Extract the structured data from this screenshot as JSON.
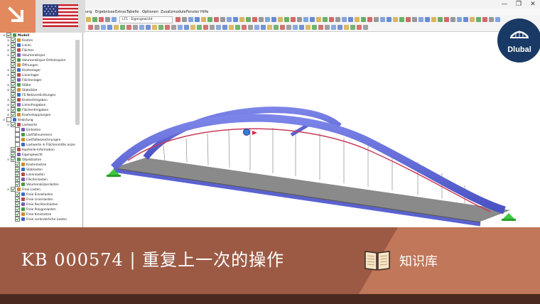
{
  "window": {
    "minimize": "—",
    "maximize": "❐",
    "close": "✕"
  },
  "menu": {
    "items": [
      "ung",
      "Ergebnisse",
      "Extras",
      "Tabelle",
      "Optionen",
      "Zusatzmodule",
      "Fenster",
      "Hilfe"
    ]
  },
  "toolbar": {
    "loadcase": "LF1 - Eigengewicht"
  },
  "navigator": {
    "rows": [
      {
        "label": "Modell",
        "level": 0,
        "checked": true,
        "expand": "⊟",
        "bold": true
      },
      {
        "label": "Knoten",
        "level": 1,
        "checked": true,
        "expand": "⊞"
      },
      {
        "label": "Linien",
        "level": 1,
        "checked": true,
        "expand": "⊞"
      },
      {
        "label": "Flächen",
        "level": 1,
        "checked": true,
        "expand": "⊞"
      },
      {
        "label": "Volumenkörper",
        "level": 1,
        "checked": true,
        "expand": "⊞"
      },
      {
        "label": "Volumenkörper-Orthotropien",
        "level": 1,
        "checked": true,
        "expand": ""
      },
      {
        "label": "Öffnungen",
        "level": 1,
        "checked": true,
        "expand": ""
      },
      {
        "label": "Knotenlager",
        "level": 1,
        "checked": true,
        "expand": "⊞"
      },
      {
        "label": "Linienlager",
        "level": 1,
        "checked": true,
        "expand": "⊞"
      },
      {
        "label": "Flächenlager",
        "level": 1,
        "checked": true,
        "expand": ""
      },
      {
        "label": "Stäbe",
        "level": 1,
        "checked": true,
        "expand": "⊞"
      },
      {
        "label": "Stabsätze",
        "level": 1,
        "checked": true,
        "expand": "⊞"
      },
      {
        "label": "FE-Netzverdichtungen",
        "level": 1,
        "checked": true,
        "expand": ""
      },
      {
        "label": "Knotenfreigaben",
        "level": 1,
        "checked": true,
        "expand": "⊞"
      },
      {
        "label": "Linienfreigaben",
        "level": 1,
        "checked": true,
        "expand": "⊞"
      },
      {
        "label": "Flächenfreigaben",
        "level": 1,
        "checked": true,
        "expand": "⊞"
      },
      {
        "label": "Knotenkopplungen",
        "level": 1,
        "checked": true,
        "expand": "⊞"
      },
      {
        "label": "Belastung",
        "level": 0,
        "checked": false,
        "expand": "⊟"
      },
      {
        "label": "Lastwerte",
        "level": 1,
        "checked": true,
        "expand": "⊟"
      },
      {
        "label": "Einheiten",
        "level": 2,
        "checked": false,
        "expand": ""
      },
      {
        "label": "Lastfallnummern",
        "level": 2,
        "checked": false,
        "expand": ""
      },
      {
        "label": "Lastfallbezeichnungen",
        "level": 2,
        "checked": false,
        "expand": ""
      },
      {
        "label": "Lastwerte in Flächenmitte anzei",
        "level": 2,
        "checked": false,
        "expand": ""
      },
      {
        "label": "Kopfzeile-Information",
        "level": 1,
        "checked": true,
        "expand": ""
      },
      {
        "label": "Eigengewicht",
        "level": 1,
        "checked": true,
        "expand": ""
      },
      {
        "label": "Objektlasten",
        "level": 1,
        "checked": true,
        "expand": "⊟"
      },
      {
        "label": "Knotenlasten",
        "level": 2,
        "checked": true,
        "expand": ""
      },
      {
        "label": "Stablasten",
        "level": 2,
        "checked": true,
        "expand": ""
      },
      {
        "label": "Linienlasten",
        "level": 2,
        "checked": true,
        "expand": ""
      },
      {
        "label": "Flächenlasten",
        "level": 2,
        "checked": true,
        "expand": ""
      },
      {
        "label": "Volumenkörperlasten",
        "level": 2,
        "checked": true,
        "expand": ""
      },
      {
        "label": "Freie Lasten",
        "level": 1,
        "checked": true,
        "expand": "⊟"
      },
      {
        "label": "Freie Einzellasten",
        "level": 2,
        "checked": true,
        "expand": ""
      },
      {
        "label": "Freie Linienlasten",
        "level": 2,
        "checked": true,
        "expand": ""
      },
      {
        "label": "Freie Rechtecklasten",
        "level": 2,
        "checked": true,
        "expand": ""
      },
      {
        "label": "Freie Polygonlasten",
        "level": 2,
        "checked": true,
        "expand": ""
      },
      {
        "label": "Freie Kreislasten",
        "level": 2,
        "checked": true,
        "expand": ""
      },
      {
        "label": "Freie veränderliche Lasten",
        "level": 2,
        "checked": true,
        "expand": ""
      }
    ]
  },
  "brand": {
    "logo_text": "Dlubal",
    "logo_color": "#1a3a66"
  },
  "banner": {
    "title": "KB 000574 | 重复上一次的操作",
    "label": "知识库",
    "color_left": "#9c5a44",
    "color_right": "#c0775a"
  },
  "icons": {
    "arrow": "arrow-down-right-icon",
    "flag": "us-flag-icon",
    "book": "book-icon"
  }
}
